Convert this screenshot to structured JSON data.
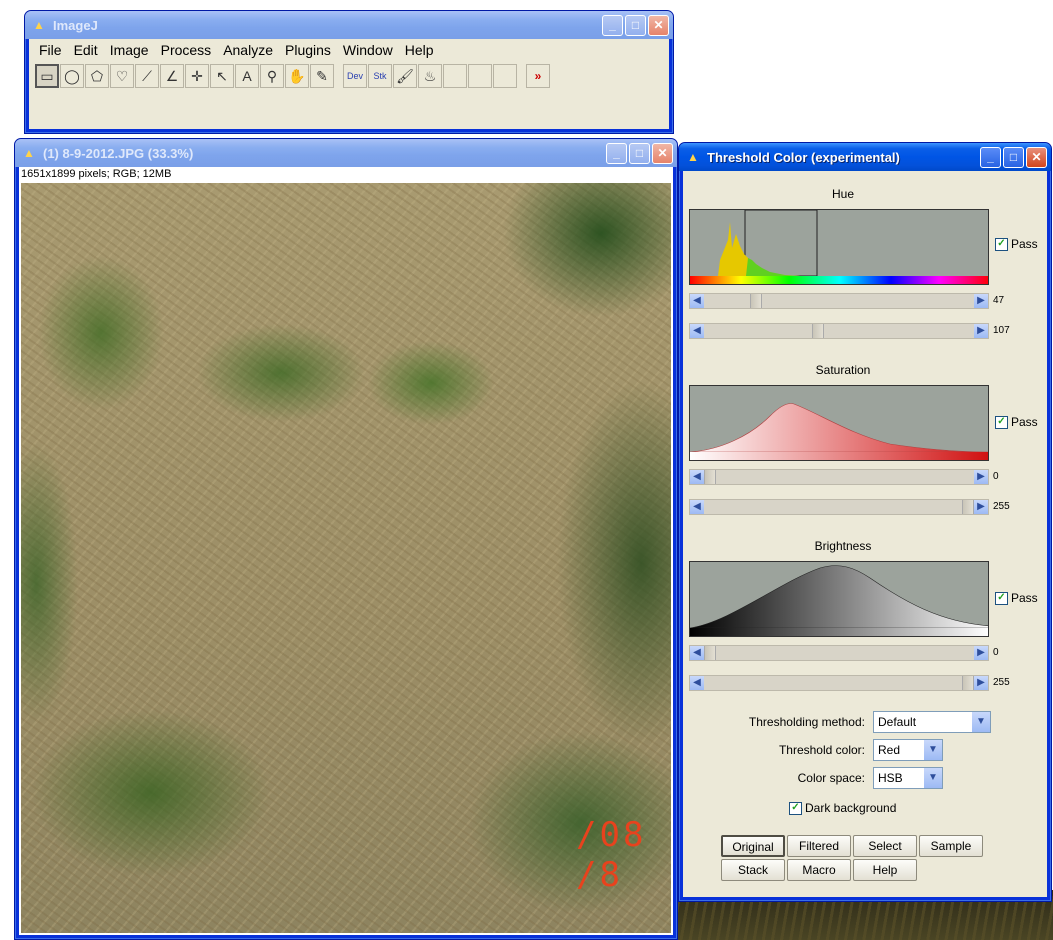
{
  "imagej": {
    "title": "ImageJ",
    "menu": [
      "File",
      "Edit",
      "Image",
      "Process",
      "Analyze",
      "Plugins",
      "Window",
      "Help"
    ],
    "more_tools": "»"
  },
  "image_window": {
    "title": "(1) 8-9-2012.JPG (33.3%)",
    "info": "1651x1899 pixels; RGB; 12MB",
    "photo_stamp": "/08 /8"
  },
  "threshold": {
    "title": "Threshold Color (experimental)",
    "hue": {
      "label": "Hue",
      "min": "47",
      "max": "107",
      "min_frac": 0.18,
      "max_frac": 0.42
    },
    "saturation": {
      "label": "Saturation",
      "min": "0",
      "max": "255",
      "min_frac": 0.0,
      "max_frac": 1.0
    },
    "brightness": {
      "label": "Brightness",
      "min": "0",
      "max": "255",
      "min_frac": 0.0,
      "max_frac": 1.0
    },
    "pass_label": "Pass",
    "thresholding_method": {
      "label": "Thresholding method:",
      "value": "Default"
    },
    "threshold_color": {
      "label": "Threshold color:",
      "value": "Red"
    },
    "color_space": {
      "label": "Color space:",
      "value": "HSB"
    },
    "dark_background": "Dark background",
    "buttons": {
      "original": "Original",
      "filtered": "Filtered",
      "select": "Select",
      "sample": "Sample",
      "stack": "Stack",
      "macro": "Macro",
      "help": "Help"
    }
  },
  "colors": {
    "xp_title": "#0055e5",
    "xp_inactive_title": "#7ea4ec",
    "client": "#ece9d8",
    "histogram_bg": "#9ca39c"
  }
}
